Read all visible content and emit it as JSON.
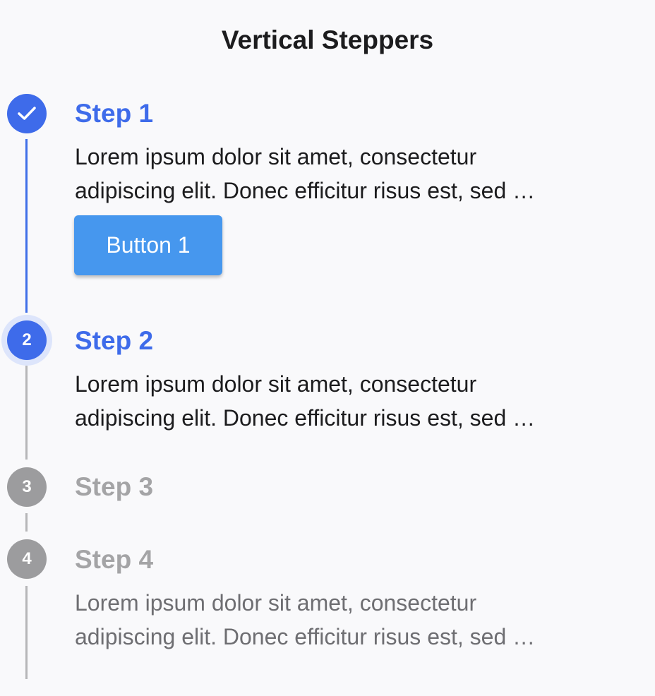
{
  "page_title": "Vertical Steppers",
  "colors": {
    "accent": "#3e6bea",
    "button": "#4697ee",
    "inactive": "#9c9c9e",
    "background": "#f9f9fb"
  },
  "steps": [
    {
      "number": "1",
      "status": "completed",
      "icon": "check-icon",
      "title": "Step 1",
      "description": "Lorem ipsum dolor sit amet, consectetur\nadipiscing elit. Donec efficitur risus est, sed …",
      "button_label": "Button 1"
    },
    {
      "number": "2",
      "status": "active",
      "title": "Step 2",
      "description": "Lorem ipsum dolor sit amet, consectetur\nadipiscing elit. Donec efficitur risus est, sed …"
    },
    {
      "number": "3",
      "status": "pending",
      "title": "Step 3"
    },
    {
      "number": "4",
      "status": "pending",
      "title": "Step 4",
      "description": "Lorem ipsum dolor sit amet, consectetur\nadipiscing elit. Donec efficitur risus est, sed …"
    }
  ]
}
